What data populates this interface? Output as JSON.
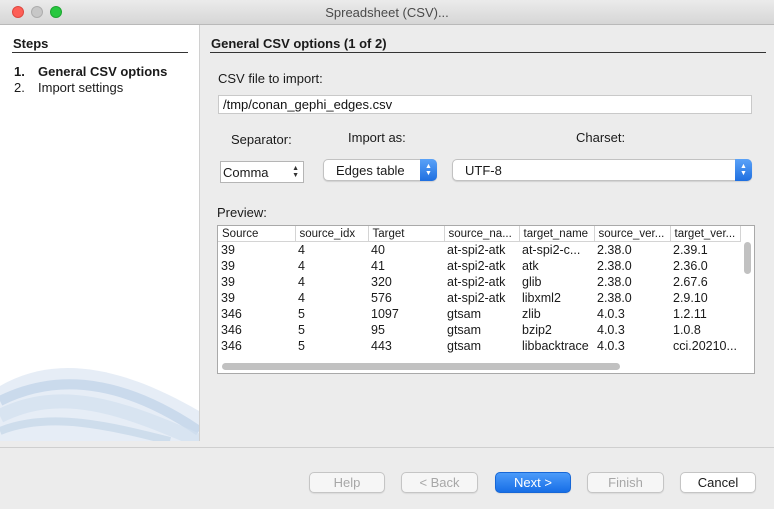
{
  "window": {
    "title": "Spreadsheet (CSV)..."
  },
  "steps": {
    "title": "Steps",
    "items": [
      {
        "num": "1.",
        "label": "General CSV options"
      },
      {
        "num": "2.",
        "label": "Import settings"
      }
    ]
  },
  "main": {
    "title": "General CSV options (1 of 2)",
    "file_label": "CSV file to import:",
    "file_value": "/tmp/conan_gephi_edges.csv",
    "separator_label": "Separator:",
    "separator_value": "Comma",
    "import_as_label": "Import as:",
    "import_as_value": "Edges table",
    "charset_label": "Charset:",
    "charset_value": "UTF-8",
    "preview_label": "Preview:"
  },
  "preview": {
    "columns": [
      "Source",
      "source_idx",
      "Target",
      "source_na...",
      "target_name",
      "source_ver...",
      "target_ver..."
    ],
    "rows": [
      [
        "39",
        "4",
        "40",
        "at-spi2-atk",
        "at-spi2-c...",
        "2.38.0",
        "2.39.1"
      ],
      [
        "39",
        "4",
        "41",
        "at-spi2-atk",
        "atk",
        "2.38.0",
        "2.36.0"
      ],
      [
        "39",
        "4",
        "320",
        "at-spi2-atk",
        "glib",
        "2.38.0",
        "2.67.6"
      ],
      [
        "39",
        "4",
        "576",
        "at-spi2-atk",
        "libxml2",
        "2.38.0",
        "2.9.10"
      ],
      [
        "346",
        "5",
        "1097",
        "gtsam",
        "zlib",
        "4.0.3",
        "1.2.11"
      ],
      [
        "346",
        "5",
        "95",
        "gtsam",
        "bzip2",
        "4.0.3",
        "1.0.8"
      ],
      [
        "346",
        "5",
        "443",
        "gtsam",
        "libbacktrace",
        "4.0.3",
        "cci.20210..."
      ]
    ]
  },
  "buttons": {
    "help": "Help",
    "back": "< Back",
    "next": "Next >",
    "finish": "Finish",
    "cancel": "Cancel"
  },
  "colors": {
    "accent": "#1f6fe0",
    "window_bg": "#ececec",
    "swoosh": "#c8d8ea"
  }
}
